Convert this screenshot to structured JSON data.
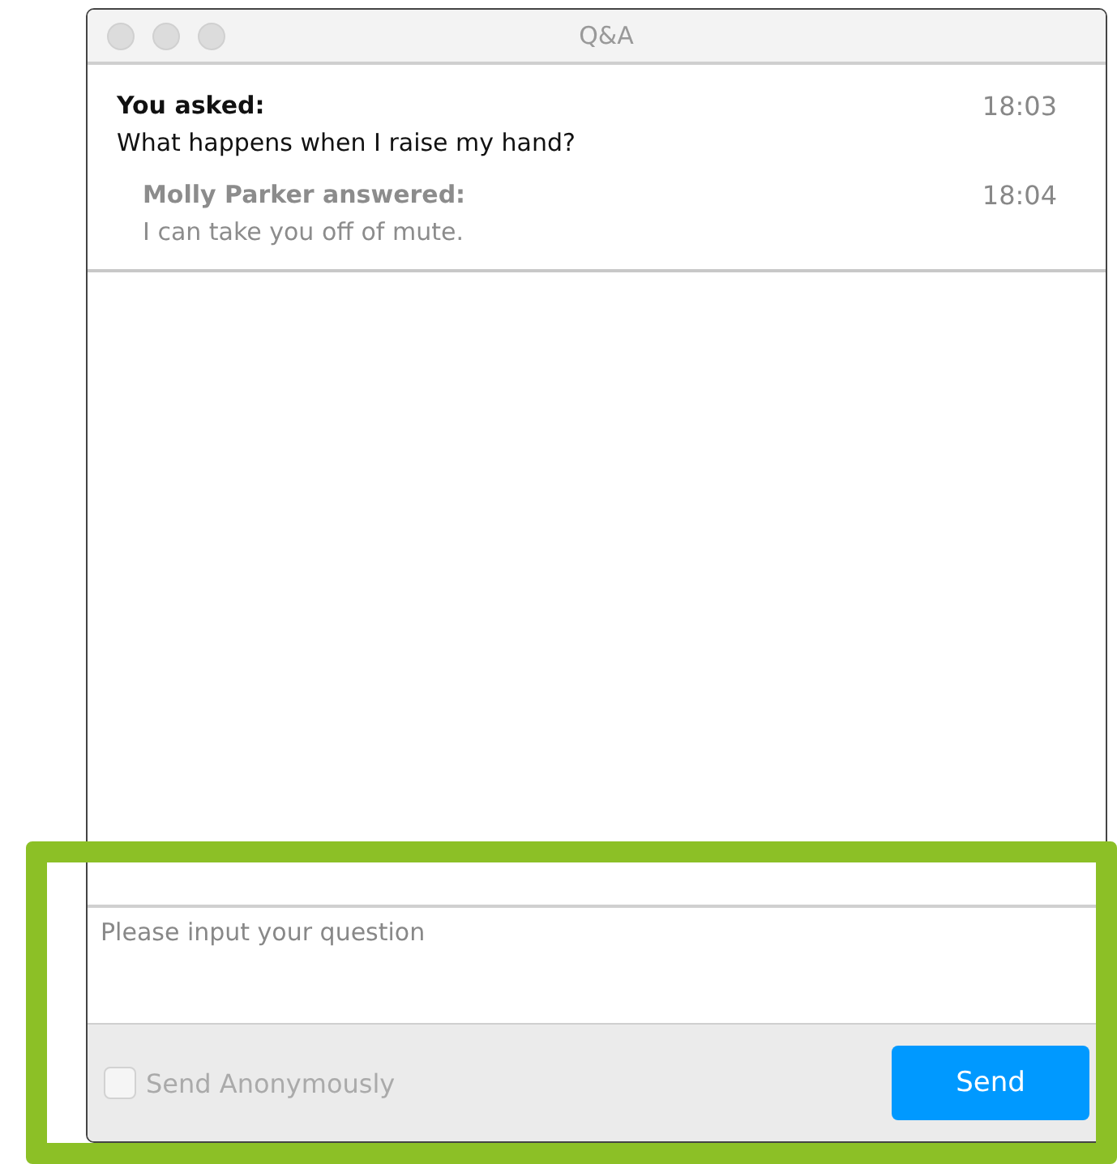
{
  "window": {
    "title": "Q&A"
  },
  "thread": {
    "question": {
      "label": "You asked:",
      "time": "18:03",
      "text": "What happens when I raise my hand?"
    },
    "answers": [
      {
        "label": "Molly Parker answered:",
        "time": "18:04",
        "text": "I can take you off of mute."
      }
    ]
  },
  "input_area": {
    "highlighted": true,
    "placeholder": "Please input your question",
    "anonymous": {
      "label": "Send Anonymously",
      "checked": false
    },
    "send_button": "Send"
  }
}
